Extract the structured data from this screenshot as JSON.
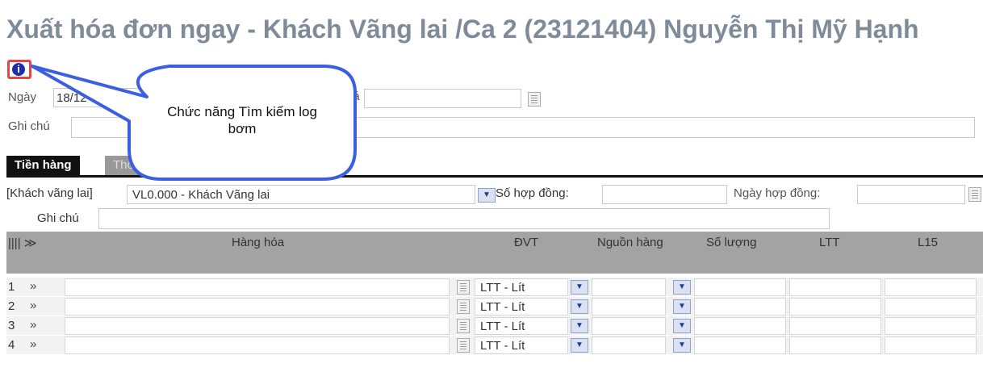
{
  "title": "Xuất hóa đơn ngay - Khách Vãng lai /Ca 2 (23121404) Nguyễn Thị Mỹ Hạnh",
  "info_icon_glyph": "i",
  "form": {
    "date_label": "Ngày",
    "date_value": "18/12",
    "price_label_fragment": "iá",
    "note_label": "Ghi chú"
  },
  "callout": {
    "text": "Chức năng Tìm kiếm log bơm"
  },
  "tabs": [
    {
      "label": "Tiền hàng",
      "active": true
    },
    {
      "label": "Thô",
      "active": false
    }
  ],
  "customer": {
    "type_label": "[Khách vãng lai]",
    "value": "VL0.000 - Khách Vãng lai",
    "contract_no_label": "Số hợp đồng:",
    "contract_date_label": "Ngày hợp đồng:",
    "note_label": "Ghi chú"
  },
  "table": {
    "col_toggle": "|||| ≫",
    "headers": {
      "item": "Hàng hóa",
      "unit": "ĐVT",
      "source": "Nguồn hàng",
      "qty": "Số lượng",
      "ltt": "LTT",
      "l15": "L15"
    },
    "rows": [
      {
        "num": "1",
        "unit": "LTT - Lít"
      },
      {
        "num": "2",
        "unit": "LTT - Lít"
      },
      {
        "num": "3",
        "unit": "LTT - Lít"
      },
      {
        "num": "4",
        "unit": "LTT - Lít"
      }
    ]
  },
  "colors": {
    "title": "#7f8b99",
    "callout_border": "#3b5fe0",
    "header_bg": "#a3a3a3",
    "info_icon": "#1c2fa8"
  }
}
